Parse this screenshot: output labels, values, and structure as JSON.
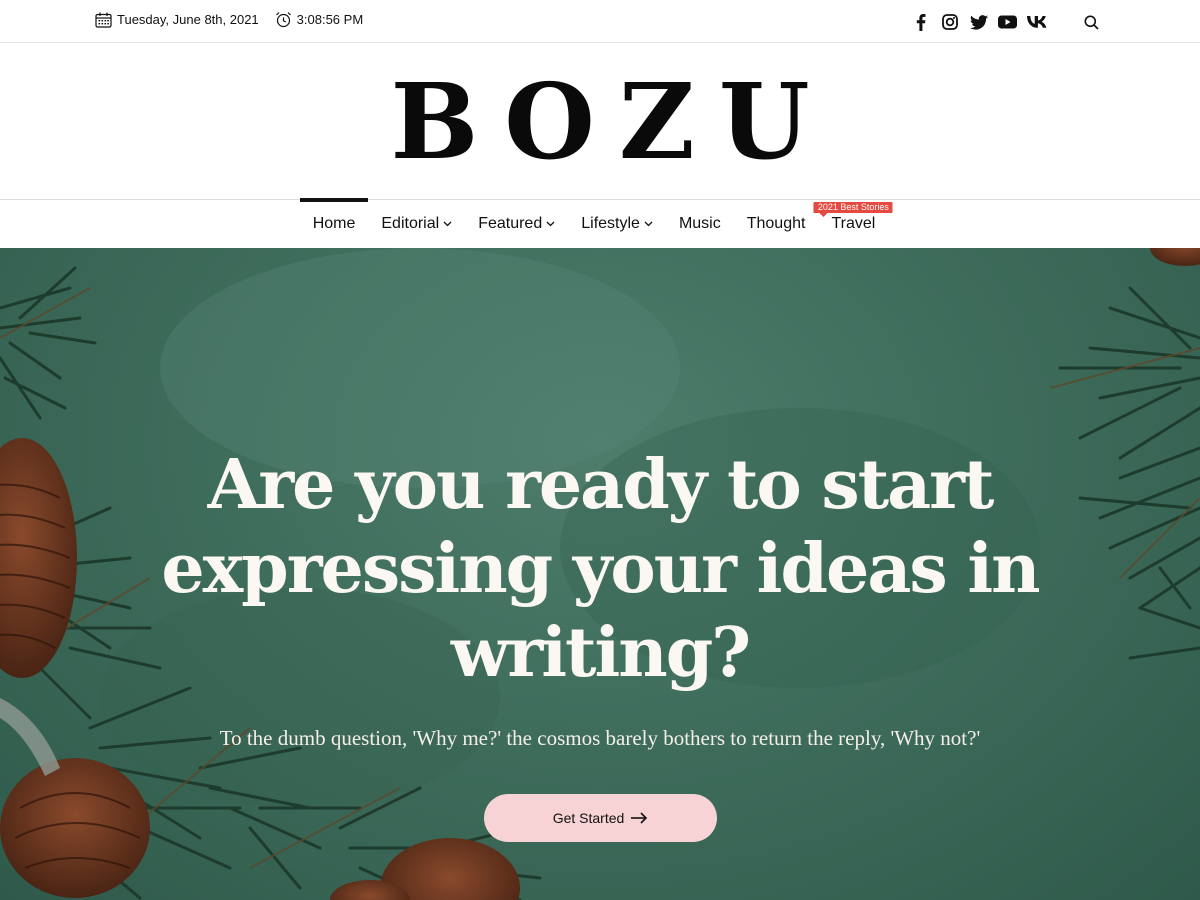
{
  "topbar": {
    "date": "Tuesday, June 8th, 2021",
    "time": "3:08:56 PM",
    "social": [
      "facebook-icon",
      "instagram-icon",
      "twitter-icon",
      "youtube-icon",
      "vk-icon"
    ]
  },
  "logo": "BOZU",
  "nav": {
    "items": [
      {
        "label": "Home",
        "active": true
      },
      {
        "label": "Editorial",
        "dropdown": true
      },
      {
        "label": "Featured",
        "dropdown": true
      },
      {
        "label": "Lifestyle",
        "dropdown": true
      },
      {
        "label": "Music"
      },
      {
        "label": "Thought"
      },
      {
        "label": "Travel",
        "badge": "2021 Best Stories"
      }
    ]
  },
  "hero": {
    "title": "Are you ready to start expressing your ideas in writing?",
    "subtitle": "To the dumb question, 'Why me?' the cosmos barely bothers to return the reply, 'Why not?'",
    "cta_label": "Get Started"
  },
  "colors": {
    "hero_bg": "#3f6d5c",
    "cta_bg": "#f8d3d5",
    "badge": "#e5493f",
    "text": "#111111"
  }
}
